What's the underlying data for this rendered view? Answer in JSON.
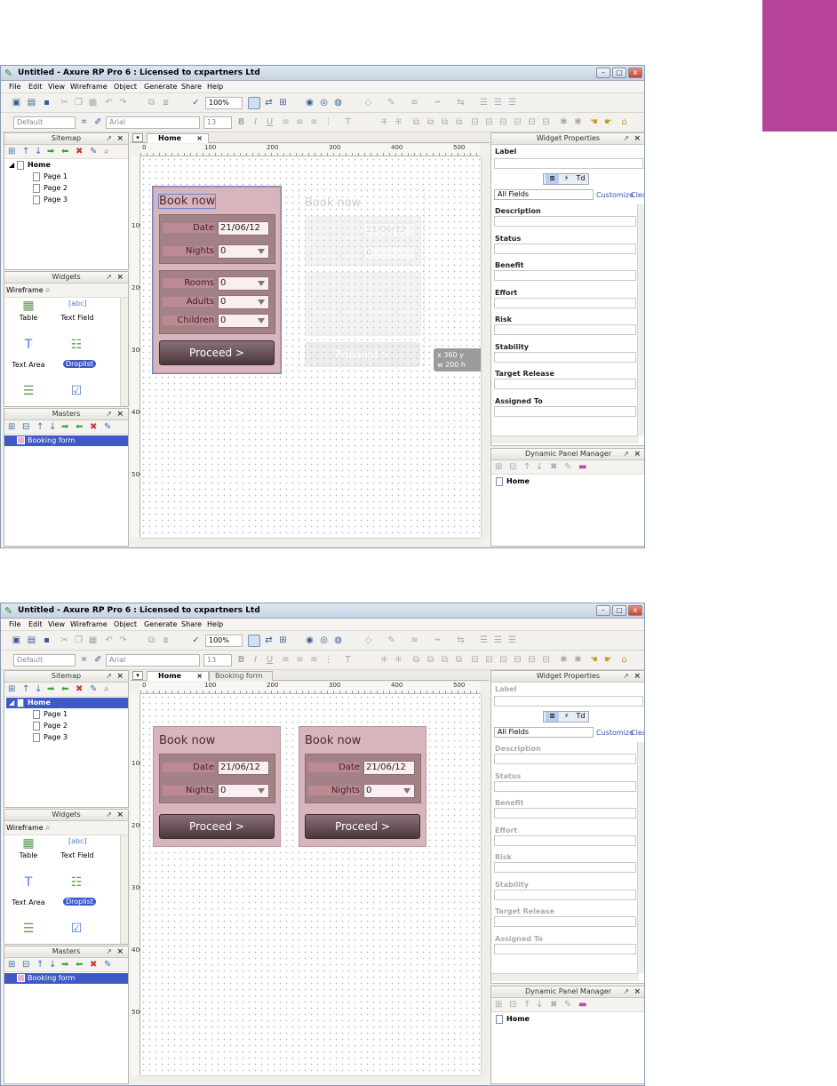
{
  "screens": [
    {
      "title": "Untitled - Axure RP Pro 6 : Licensed to cxpartners Ltd",
      "menu": [
        "File",
        "Edit",
        "View",
        "Wireframe",
        "Object",
        "Generate",
        "Share",
        "Help"
      ],
      "toolbar": {
        "zoom": "100%",
        "font_style": "Default",
        "font_name": "Arial",
        "font_size": "13"
      },
      "sitemap": {
        "title": "Sitemap",
        "root": "Home",
        "pages": [
          "Page 1",
          "Page 2",
          "Page 3"
        ]
      },
      "widgets": {
        "title": "Widgets",
        "library": "Wireframe",
        "items": [
          "Table",
          "Text Field",
          "Text Area",
          "Droplist"
        ]
      },
      "masters": {
        "title": "Masters",
        "items": [
          "Booking form"
        ]
      },
      "tabs": [
        "Home"
      ],
      "ruler_h": [
        "0",
        "100",
        "200",
        "300",
        "400",
        "500"
      ],
      "ruler_v": [
        "100",
        "200",
        "300",
        "400",
        "500"
      ],
      "form": {
        "title": "Book now",
        "date_label": "Date",
        "date_value": "21/06/12",
        "nights_label": "Nights",
        "nights_value": "0",
        "rooms_label": "Rooms",
        "rooms_value": "0",
        "adults_label": "Adults",
        "adults_value": "0",
        "children_label": "Children",
        "children_value": "0",
        "proceed": "Proceed >"
      },
      "ghost_form": {
        "title": "Book now",
        "date_value": "21/06/12",
        "nights_value": "0",
        "proceed": "Proceed >"
      },
      "size_hint": {
        "line1": "x 360 y",
        "line2": "w 200 h"
      },
      "widget_properties": {
        "title": "Widget Properties",
        "label": "Label",
        "filter": "All Fields",
        "customize": "Customize",
        "clear": "Clear",
        "fields": [
          "Description",
          "Status",
          "Benefit",
          "Effort",
          "Risk",
          "Stability",
          "Target Release",
          "Assigned To"
        ]
      },
      "dpm": {
        "title": "Dynamic Panel Manager",
        "items": [
          "Home"
        ]
      }
    },
    {
      "title": "Untitled - Axure RP Pro 6 : Licensed to cxpartners Ltd",
      "menu": [
        "File",
        "Edit",
        "View",
        "Wireframe",
        "Object",
        "Generate",
        "Share",
        "Help"
      ],
      "toolbar": {
        "zoom": "100%",
        "font_style": "Default",
        "font_name": "Arial",
        "font_size": "13"
      },
      "sitemap": {
        "title": "Sitemap",
        "root": "Home",
        "pages": [
          "Page 1",
          "Page 2",
          "Page 3"
        ]
      },
      "widgets": {
        "title": "Widgets",
        "library": "Wireframe",
        "items": [
          "Table",
          "Text Field",
          "Text Area",
          "Droplist"
        ]
      },
      "masters": {
        "title": "Masters",
        "items": [
          "Booking form"
        ]
      },
      "tabs": [
        "Home",
        "Booking form"
      ],
      "ruler_h": [
        "0",
        "100",
        "200",
        "300",
        "400",
        "500"
      ],
      "ruler_v": [
        "100",
        "200",
        "300",
        "400",
        "500"
      ],
      "form_a": {
        "title": "Book now",
        "date_label": "Date",
        "date_value": "21/06/12",
        "nights_label": "Nights",
        "nights_value": "0",
        "proceed": "Proceed >"
      },
      "form_b": {
        "title": "Book now",
        "date_label": "Date",
        "date_value": "21/06/12",
        "nights_label": "Nights",
        "nights_value": "0",
        "proceed": "Proceed >"
      },
      "widget_properties": {
        "title": "Widget Properties",
        "label": "Label",
        "filter": "All Fields",
        "customize": "Customize",
        "clear": "Clear",
        "fields": [
          "Description",
          "Status",
          "Benefit",
          "Effort",
          "Risk",
          "Stability",
          "Target Release",
          "Assigned To"
        ]
      },
      "dpm": {
        "title": "Dynamic Panel Manager",
        "items": [
          "Home"
        ]
      }
    }
  ],
  "colors": {
    "accent_tab": "#b8439a",
    "form_bg": "#d8b4bc",
    "selection": "#3f59c8"
  }
}
